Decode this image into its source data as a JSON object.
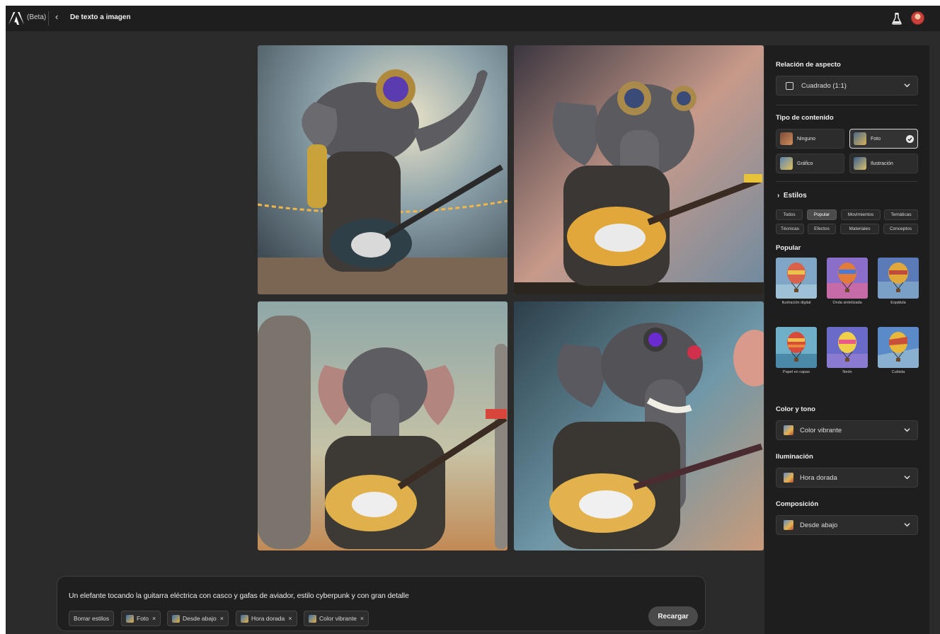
{
  "header": {
    "beta_label": "(Beta)",
    "back_glyph": "‹",
    "breadcrumb": "De texto a imagen",
    "icons": [
      "adobe-logo",
      "chevron-left-icon",
      "flask-icon",
      "avatar"
    ]
  },
  "colors": {
    "app_bg": "#2b2b2b",
    "topbar_bg": "#1e1e1e",
    "panel_bg": "#1e1e1e",
    "accent_text": "#f0f0f0"
  },
  "prompt": {
    "text": "Un elefante tocando la guitarra eléctrica con casco y gafas de aviador, estilo cyberpunk y con gran detalle",
    "clear_label": "Borrar estilos",
    "chips": [
      {
        "label": "Foto",
        "remove": "×"
      },
      {
        "label": "Desde abajo",
        "remove": "×"
      },
      {
        "label": "Hora dorada",
        "remove": "×"
      },
      {
        "label": "Color vibrante",
        "remove": "×"
      }
    ],
    "reload_label": "Recargar"
  },
  "panel": {
    "aspect": {
      "title": "Relación de aspecto",
      "value": "Cuadrado (1:1)"
    },
    "content_type": {
      "title": "Tipo de contenido",
      "options": [
        {
          "label": "Ninguno",
          "selected": false
        },
        {
          "label": "Foto",
          "selected": true
        },
        {
          "label": "Gráfico",
          "selected": false
        },
        {
          "label": "Ilustración",
          "selected": false
        }
      ]
    },
    "styles": {
      "toggle": "›",
      "title": "Estilos",
      "tabs": [
        "Todos",
        "Popular",
        "Movimientos",
        "Temáticas",
        "Técnicas",
        "Efectos",
        "Materiales",
        "Conceptos"
      ],
      "active_tab": "Popular",
      "section_title": "Popular",
      "items": [
        "Ilustración digital",
        "Onda sintetizada",
        "Espátula",
        "Papel en capas",
        "Neón",
        "Cubista"
      ]
    },
    "color_tone": {
      "title": "Color y tono",
      "value": "Color vibrante"
    },
    "lighting": {
      "title": "Iluminación",
      "value": "Hora dorada"
    },
    "composition": {
      "title": "Composición",
      "value": "Desde abajo"
    }
  }
}
